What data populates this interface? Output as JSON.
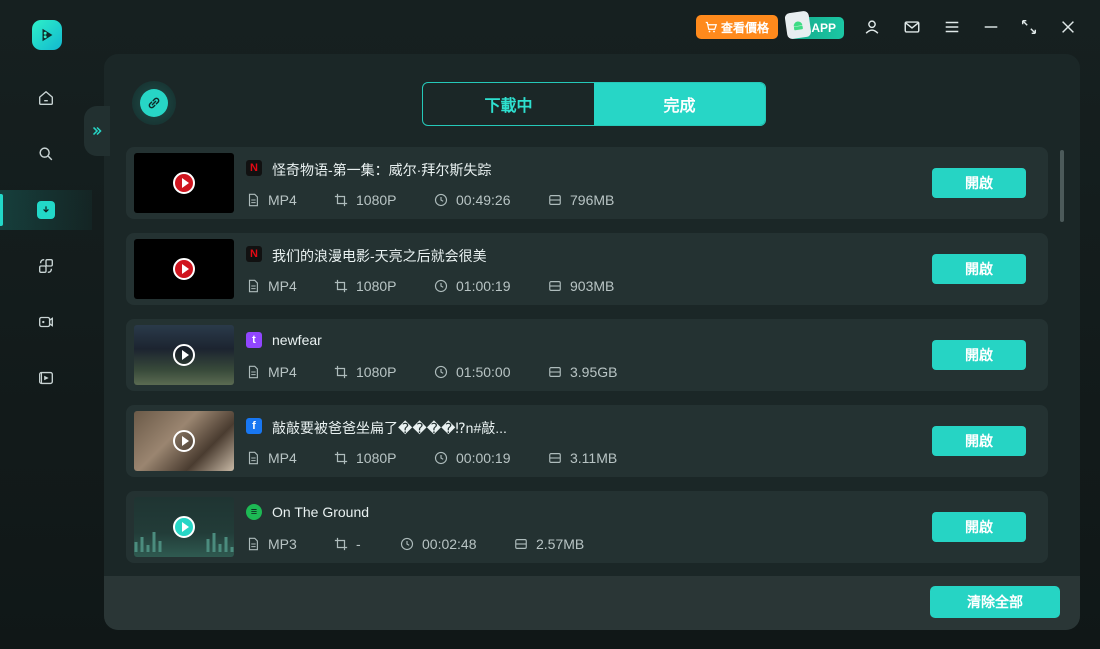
{
  "topbar": {
    "price_label": "查看價格",
    "app_label": "APP"
  },
  "tabs": [
    {
      "label": "下載中",
      "active": false
    },
    {
      "label": "完成",
      "active": true
    }
  ],
  "downloads": [
    {
      "source": "netflix",
      "title": "怪奇物语-第一集：威尔·拜尔斯失踪",
      "format": "MP4",
      "resolution": "1080P",
      "duration": "00:49:26",
      "size": "796MB",
      "open_label": "開啟"
    },
    {
      "source": "netflix",
      "title": "我们的浪漫电影-天亮之后就会很美",
      "format": "MP4",
      "resolution": "1080P",
      "duration": "01:00:19",
      "size": "903MB",
      "open_label": "開啟"
    },
    {
      "source": "twitch",
      "title": "newfear",
      "format": "MP4",
      "resolution": "1080P",
      "duration": "01:50:00",
      "size": "3.95GB",
      "open_label": "開啟"
    },
    {
      "source": "facebook",
      "title": "敲敲要被爸爸坐扁了����⁉n#敲...",
      "format": "MP4",
      "resolution": "1080P",
      "duration": "00:00:19",
      "size": "3.11MB",
      "open_label": "開啟"
    },
    {
      "source": "spotify",
      "title": "On The Ground",
      "format": "MP3",
      "resolution": "-",
      "duration": "00:02:48",
      "size": "2.57MB",
      "open_label": "開啟"
    }
  ],
  "footer": {
    "clear_all_label": "清除全部"
  },
  "colors": {
    "accent": "#26d4c4",
    "price_orange": "#ff8a1c",
    "netflix": "#e50914",
    "twitch": "#9146ff",
    "facebook": "#1877f2",
    "spotify": "#1db954"
  }
}
